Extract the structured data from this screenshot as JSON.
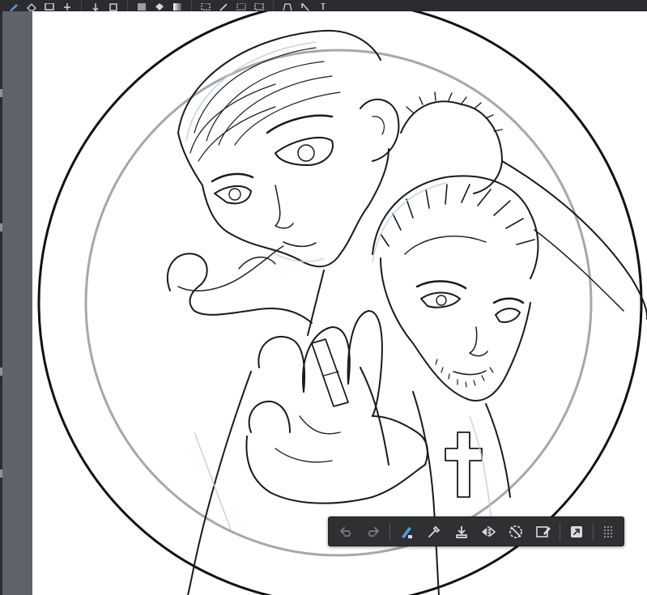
{
  "app": {
    "accent_color": "#4a9fd8",
    "canvas_color": "#ffffff",
    "toolbar_color": "#2a2c30"
  },
  "top_toolbar": {
    "groups": [
      [
        "brush-icon",
        "eraser-icon",
        "rectangle-icon",
        "move-icon"
      ],
      [
        "transform-vertical-icon",
        "layer-copy-icon"
      ],
      [
        "fill-swatch-icon",
        "paint-bucket-icon",
        "gradient-icon"
      ],
      [
        "selection-rect-icon",
        "selection-pen-icon",
        "selection-lasso-icon",
        "selection-magic-icon"
      ],
      [
        "perspective-icon",
        "pointer-icon",
        "text-icon"
      ]
    ]
  },
  "canvas": {
    "artwork": "line-art-illustration"
  },
  "quick_bar": {
    "items": [
      {
        "icon": "undo-icon",
        "enabled": false
      },
      {
        "icon": "redo-icon",
        "enabled": false
      },
      {
        "icon": "brush-eraser-icon",
        "enabled": true
      },
      {
        "icon": "eyedropper-icon",
        "enabled": true
      },
      {
        "icon": "merge-down-icon",
        "enabled": true
      },
      {
        "icon": "flip-horizontal-icon",
        "enabled": true
      },
      {
        "icon": "rotate-reset-icon",
        "enabled": true
      },
      {
        "icon": "edit-selection-icon",
        "enabled": true
      },
      {
        "icon": "expand-icon",
        "enabled": true
      },
      {
        "icon": "grip-icon",
        "enabled": true
      }
    ]
  }
}
